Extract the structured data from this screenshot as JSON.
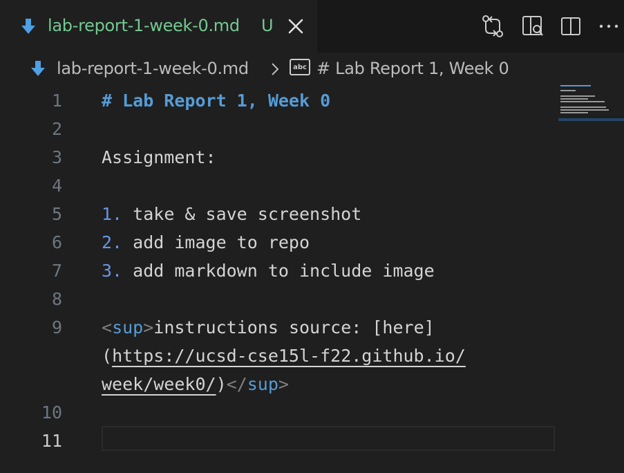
{
  "tab": {
    "title": "lab-report-1-week-0.md",
    "status": "U",
    "icon": "markdown-download-icon",
    "title_color": "#73c991"
  },
  "breadcrumb": {
    "file": "lab-report-1-week-0.md",
    "symbol": "# Lab Report 1, Week 0",
    "symbol_icon_text": "abc"
  },
  "editor": {
    "line_numbers": [
      "1",
      "2",
      "3",
      "4",
      "5",
      "6",
      "7",
      "8",
      "9",
      "10",
      "11"
    ],
    "lines": {
      "l1": "# Lab Report 1, Week 0",
      "l3": "Assignment:",
      "l5_num": "1.",
      "l5_text": " take & save screenshot",
      "l6_num": "2.",
      "l6_text": " add image to repo",
      "l7_num": "3.",
      "l7_text": " add markdown to include image",
      "l9_open_lt": "<",
      "l9_open_tag": "sup",
      "l9_open_gt": ">",
      "l9_text": "instructions source: [here]",
      "l9b_paren": "(",
      "l9b_url": "https://ucsd-cse15l-f22.github.io/",
      "l9c_url": "week/week0/",
      "l9c_paren": ")",
      "l9c_close_lt": "</",
      "l9c_close_tag": "sup",
      "l9c_close_gt": ">"
    },
    "active_line": "11"
  },
  "colors": {
    "background": "#1f1f1f",
    "tabbar": "#181818",
    "heading": "#569cd6",
    "list_number": "#6796e6",
    "text": "#d4d4d4",
    "untracked": "#73c991"
  }
}
